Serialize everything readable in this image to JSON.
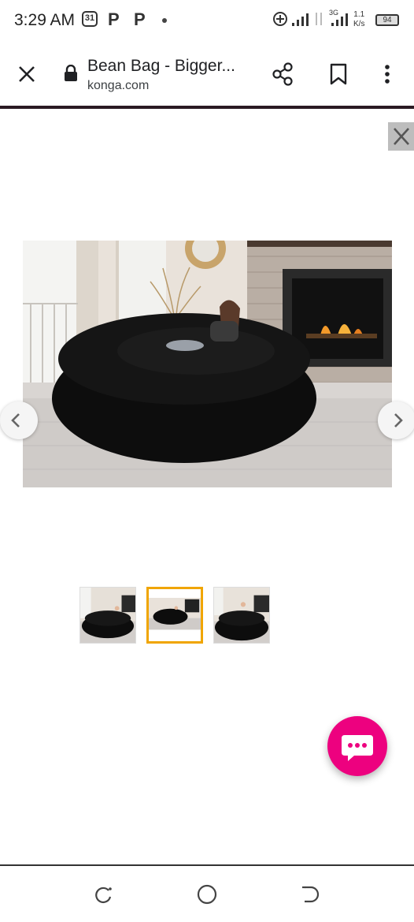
{
  "status_bar": {
    "time": "3:29 AM",
    "notification_icons": [
      "calendar-icon",
      "p-app-icon",
      "p-app-icon"
    ],
    "network_type": "3G",
    "net_speed_value": "1.1",
    "net_speed_unit": "K/s",
    "battery_level": "94"
  },
  "browser": {
    "page_title": "Bean Bag - Bigger...",
    "domain": "konga.com",
    "icons": [
      "close-icon",
      "lock-icon",
      "share-icon",
      "bookmark-icon",
      "more-vert-icon"
    ]
  },
  "viewer": {
    "selected_thumbnail_index": 1,
    "thumbnail_count": 3,
    "colors": {
      "selected_border": "#f0a500",
      "chat_button": "#ed017f",
      "bean_bag": "#0d0d0d"
    }
  },
  "android_nav": {
    "icons": [
      "recent-apps-icon",
      "home-icon",
      "back-icon"
    ]
  }
}
